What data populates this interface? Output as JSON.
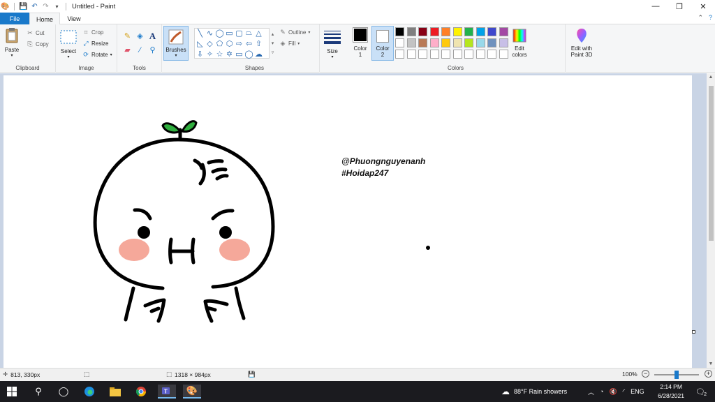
{
  "window": {
    "title": "Untitled - Paint",
    "minimize": "—",
    "restore": "❐",
    "close": "✕"
  },
  "tabs": {
    "file": "File",
    "home": "Home",
    "view": "View",
    "collapse": "⌃",
    "help": "?"
  },
  "clipboard": {
    "group_label": "Clipboard",
    "paste": "Paste",
    "cut": "Cut",
    "copy": "Copy"
  },
  "image": {
    "group_label": "Image",
    "select": "Select",
    "crop": "Crop",
    "resize": "Resize",
    "rotate": "Rotate"
  },
  "tools": {
    "group_label": "Tools",
    "brushes": "Brushes"
  },
  "shapes": {
    "group_label": "Shapes",
    "outline": "Outline",
    "fill": "Fill"
  },
  "size": {
    "label": "Size"
  },
  "colors": {
    "group_label": "Colors",
    "color1_label": "Color",
    "color1_num": "1",
    "color2_label": "Color",
    "color2_num": "2",
    "color1": "#000000",
    "color2": "#ffffff",
    "edit_colors_1": "Edit",
    "edit_colors_2": "colors",
    "paint3d_1": "Edit with",
    "paint3d_2": "Paint 3D",
    "palette_row1": [
      "#000000",
      "#7f7f7f",
      "#880015",
      "#ed1c24",
      "#ff7f27",
      "#fff200",
      "#22b14c",
      "#00a2e8",
      "#3f48cc",
      "#a349a4"
    ],
    "palette_row2": [
      "#ffffff",
      "#c3c3c3",
      "#b97a57",
      "#ffaec9",
      "#ffc90e",
      "#efe4b0",
      "#b5e61d",
      "#99d9ea",
      "#7092be",
      "#c8bfe7"
    ],
    "palette_row3": [
      "#ffffff",
      "#ffffff",
      "#ffffff",
      "#ffffff",
      "#ffffff",
      "#ffffff",
      "#ffffff",
      "#ffffff",
      "#ffffff",
      "#ffffff"
    ]
  },
  "canvas": {
    "signature_line1": "@Phuongnguyenanh",
    "signature_line2": "#Hoidap247",
    "stroke_color": "#000000",
    "cheek_color": "#f5a89a",
    "leaf_color": "#2fae3e"
  },
  "status": {
    "cursor_position": "813, 330px",
    "image_size": "1318 × 984px",
    "zoom": "100%",
    "zoom_out": "−",
    "zoom_in": "+"
  },
  "taskbar": {
    "weather": "88°F  Rain showers",
    "language": "ENG",
    "time": "2:14 PM",
    "date": "6/28/2021",
    "notification_count": "2"
  }
}
